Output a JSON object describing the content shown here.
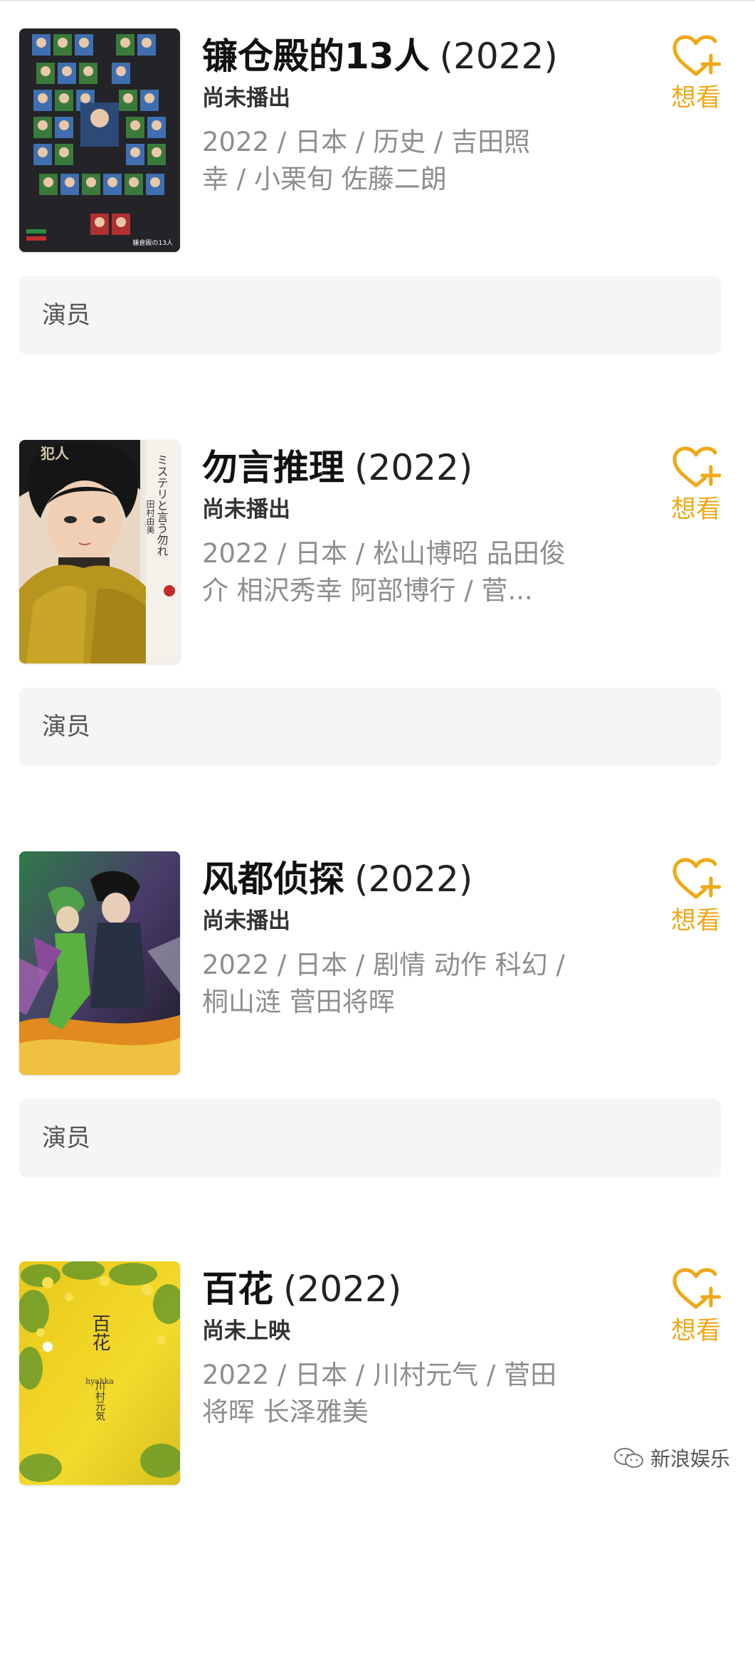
{
  "entries": [
    {
      "title": "镰仓殿的13人",
      "year": "(2022)",
      "status": "尚未播出",
      "meta_line1": "2022 / 日本 / 历史 / 吉田照",
      "meta_line2": "幸 / 小栗旬 佐藤二朗",
      "want_label": "想看",
      "actor_label": "演员"
    },
    {
      "title": "勿言推理",
      "year": "(2022)",
      "status": "尚未播出",
      "meta_line1": "2022 / 日本 / 松山博昭 品田俊",
      "meta_line2": "介 相沢秀幸 阿部博行 / 菅...",
      "want_label": "想看",
      "actor_label": "演员"
    },
    {
      "title": "风都侦探",
      "year": "(2022)",
      "status": "尚未播出",
      "meta_line1": "2022 / 日本 / 剧情 动作 科幻 /",
      "meta_line2": "桐山涟 菅田将晖",
      "want_label": "想看",
      "actor_label": "演员"
    },
    {
      "title": "百花",
      "year": "(2022)",
      "status": "尚未上映",
      "meta_line1": "2022 / 日本 / 川村元气 / 菅田",
      "meta_line2": "将晖 长泽雅美",
      "want_label": "想看"
    }
  ],
  "posters": {
    "p1_corner": "鎌倉殿の13人",
    "p2_top": "犯人",
    "p2_side": "ミステリと言う勿れ",
    "p2_author": "田村由美",
    "p4_title": "百花",
    "p4_sub": "hyakka",
    "p4_author": "川村元気"
  },
  "watermark": "新浪娱乐",
  "colors": {
    "accent": "#f0a818",
    "meta_gray": "#8e8e8e",
    "actor_bg": "#f5f5f5"
  }
}
